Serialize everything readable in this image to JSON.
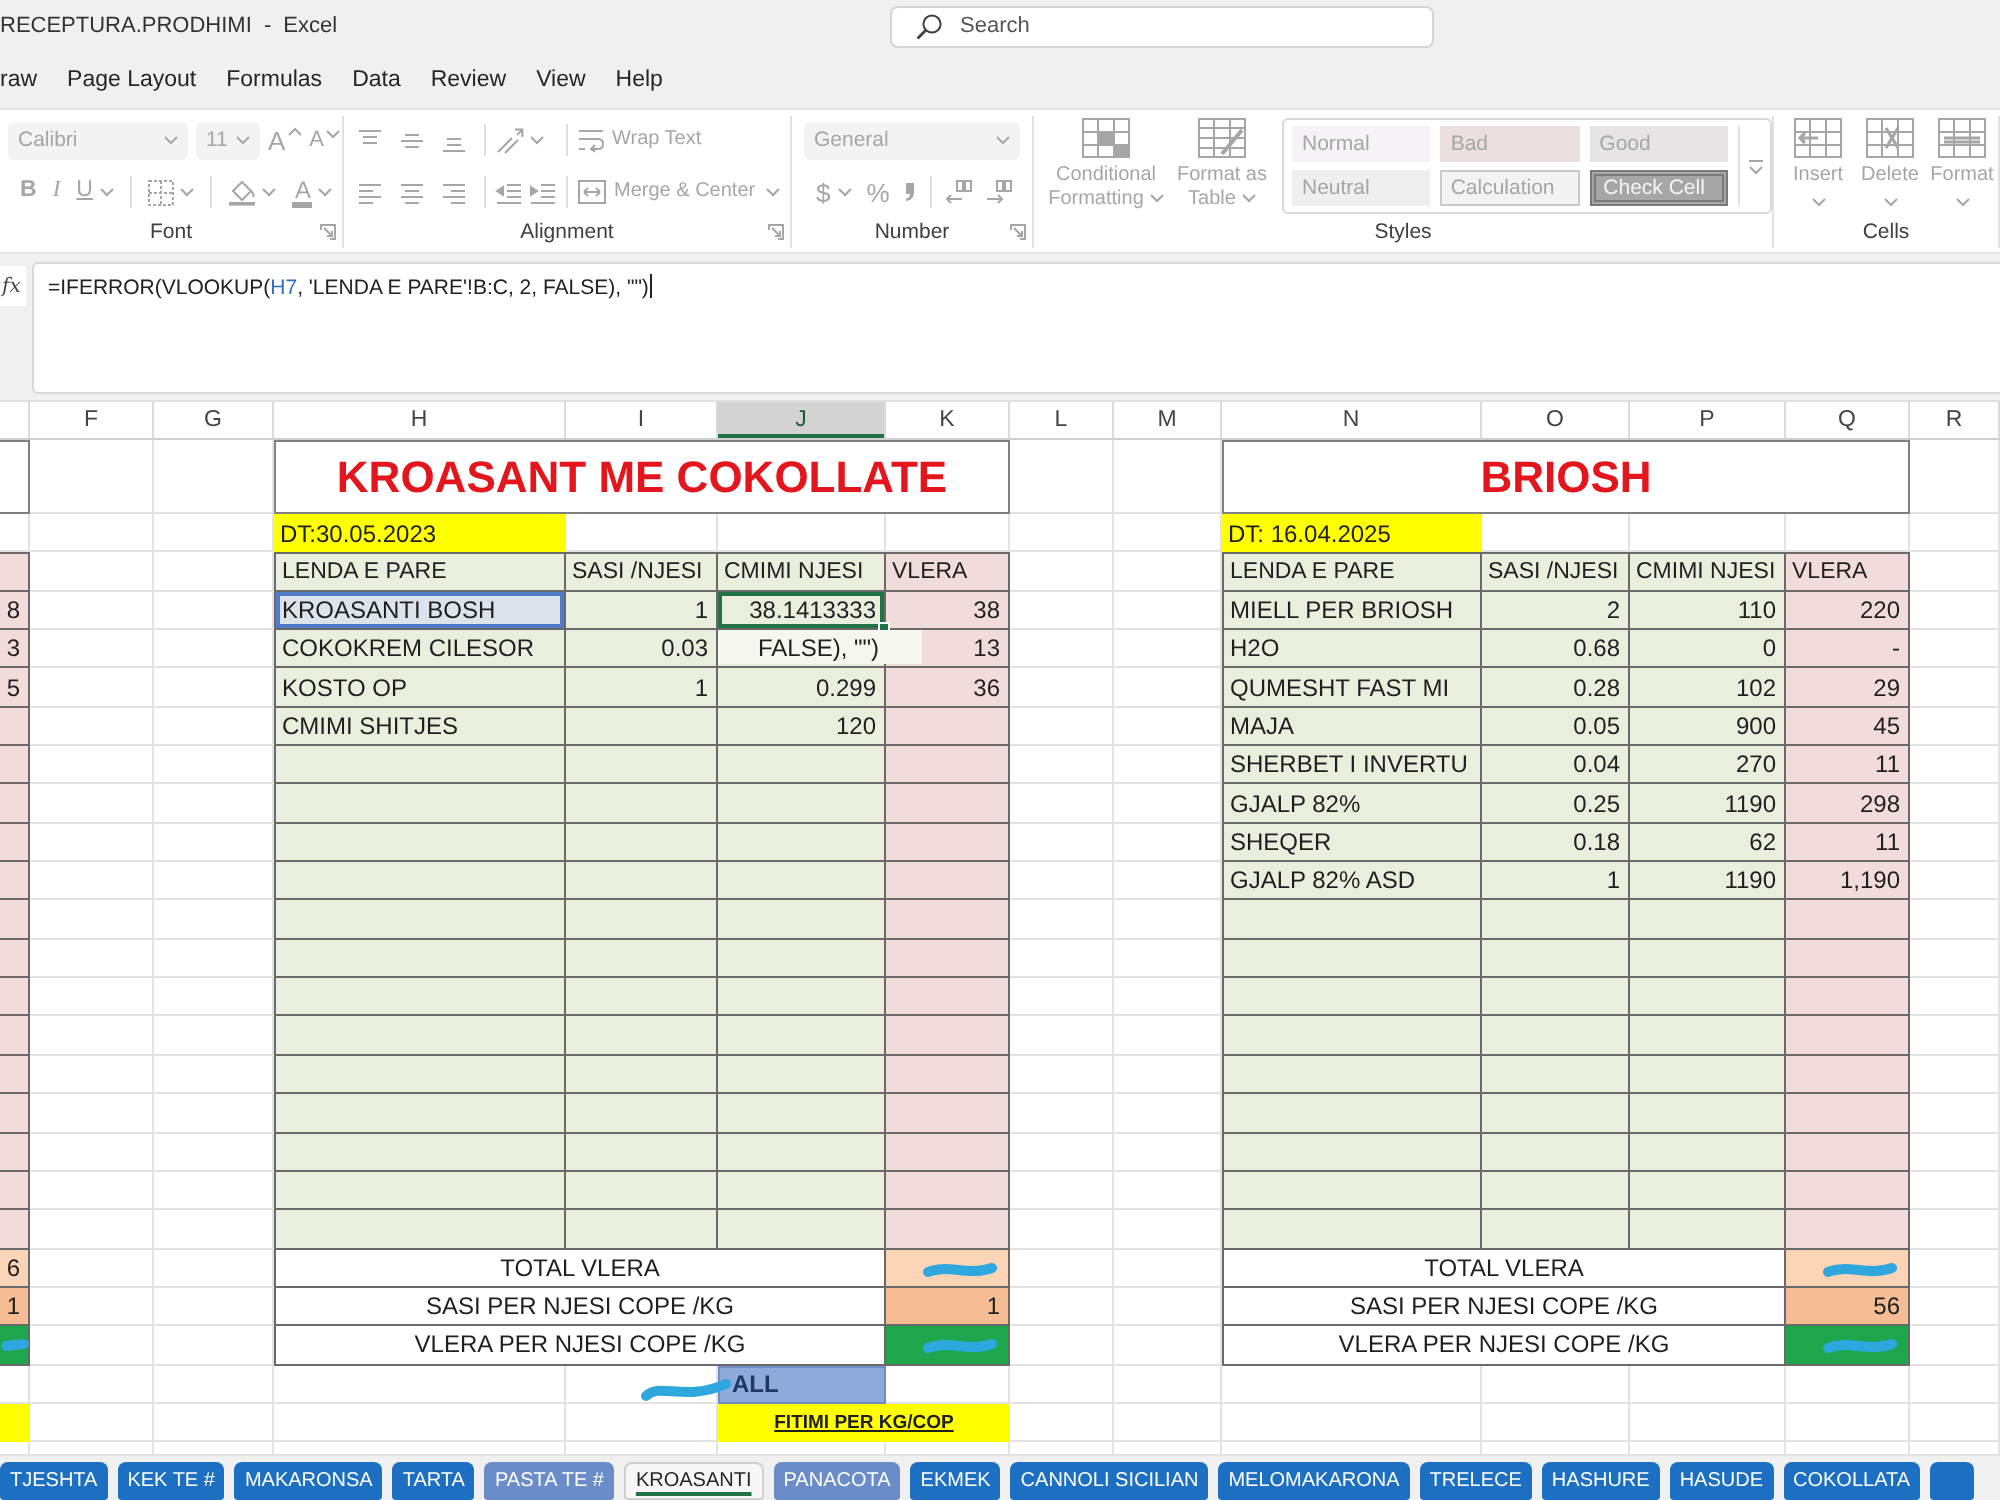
{
  "window": {
    "title": "RECEPTURA.PRODHIMI - Excel"
  },
  "search": {
    "placeholder": "Search"
  },
  "menu": [
    "raw",
    "Page Layout",
    "Formulas",
    "Data",
    "Review",
    "View",
    "Help"
  ],
  "ribbon": {
    "disabled": true,
    "font": {
      "label": "Font",
      "font_name": "Calibri",
      "font_size": "11",
      "size_buttons": [
        {
          "label": "A",
          "kind": "grow"
        },
        {
          "label": "A",
          "kind": "shrink"
        }
      ],
      "style_buttons": [
        {
          "label": "B",
          "kind": "bold"
        },
        {
          "label": "I",
          "kind": "italic"
        },
        {
          "label": "U",
          "kind": "underline"
        }
      ],
      "font_color": "A"
    },
    "alignment": {
      "label": "Alignment",
      "wrap_text": "Wrap Text",
      "merge": "Merge & Center"
    },
    "number": {
      "label": "Number",
      "format": "General",
      "currency": "$",
      "percent": "%"
    },
    "styles": {
      "label": "Styles",
      "conditional_formatting": "Conditional Formatting",
      "format_as_table": "Format as Table",
      "gallery": [
        {
          "label": "Normal",
          "kind": "normal"
        },
        {
          "label": "Bad",
          "kind": "bad"
        },
        {
          "label": "Good",
          "kind": "good"
        },
        {
          "label": "Neutral",
          "kind": "neutral"
        },
        {
          "label": "Calculation",
          "kind": "calculation"
        },
        {
          "label": "Check Cell",
          "kind": "check"
        }
      ]
    },
    "cells": {
      "label": "Cells",
      "buttons": [
        {
          "label": "Insert",
          "kind": "insert"
        },
        {
          "label": "Delete",
          "kind": "delete"
        },
        {
          "label": "Format",
          "kind": "format"
        }
      ]
    }
  },
  "formula_bar": {
    "label": "fx",
    "formula": [
      {
        "text": "=IFERROR(VLOOKUP(",
        "kind": "plain"
      },
      {
        "text": "H7",
        "kind": "reference"
      },
      {
        "text": ", 'LENDA E PARE'!B:C, 2, FALSE), \"\")",
        "kind": "plain"
      }
    ]
  },
  "column_headers": [
    {
      "label": "F",
      "selected": false
    },
    {
      "label": "G",
      "selected": false
    },
    {
      "label": "H",
      "selected": false
    },
    {
      "label": "I",
      "selected": false
    },
    {
      "label": "J",
      "selected": true
    },
    {
      "label": "K",
      "selected": false
    },
    {
      "label": "L",
      "selected": false
    },
    {
      "label": "M",
      "selected": false
    },
    {
      "label": "N",
      "selected": false
    },
    {
      "label": "O",
      "selected": false
    },
    {
      "label": "P",
      "selected": false
    },
    {
      "label": "Q",
      "selected": false
    },
    {
      "label": "R",
      "selected": false
    }
  ],
  "sheet": {
    "edge_table": {
      "values": [
        "8",
        "3",
        "5"
      ],
      "totals": [
        {
          "kind": "total",
          "value": "6",
          "redacted": false
        },
        {
          "kind": "quantity",
          "value": "1",
          "redacted": false
        },
        {
          "kind": "result",
          "redacted": true
        }
      ]
    },
    "tables": [
      {
        "title": "KROASANT ME COKOLLATE",
        "date": "DT:30.05.2023",
        "columns": [
          "LENDA E PARE",
          "SASI /NJESI",
          "CMIMI NJESI",
          "VLERA"
        ],
        "rows": [
          {
            "cells": [
              {
                "text": "KROASANTI BOSH",
                "kind": "reference"
              },
              {
                "text": "1",
                "kind": "plain"
              },
              {
                "text": "38.1413333",
                "kind": "active"
              },
              {
                "text": "38",
                "kind": "plain"
              }
            ]
          },
          {
            "cells": [
              {
                "text": "COKOKREM CILESOR",
                "kind": "plain"
              },
              {
                "text": "0.03",
                "kind": "plain"
              },
              {
                "text": "FALSE), \"\")",
                "kind": "editor"
              },
              {
                "text": "13",
                "kind": "plain"
              }
            ]
          },
          {
            "cells": [
              {
                "text": "KOSTO OP",
                "kind": "plain"
              },
              {
                "text": "1",
                "kind": "plain"
              },
              {
                "text": "0.299",
                "kind": "plain"
              },
              {
                "text": "36",
                "kind": "plain"
              }
            ]
          },
          {
            "cells": [
              {
                "text": "CMIMI SHITJES",
                "kind": "plain"
              },
              {
                "kind": "empty"
              },
              {
                "text": "120",
                "kind": "plain"
              },
              {
                "kind": "empty"
              }
            ]
          }
        ],
        "totals": [
          {
            "label": "TOTAL VLERA",
            "kind": "total",
            "redacted": true
          },
          {
            "label": "SASI PER NJESI COPE /KG",
            "kind": "quantity",
            "value": "1",
            "redacted": false
          },
          {
            "label": "VLERA PER NJESI COPE /KG",
            "kind": "result",
            "redacted": true
          }
        ],
        "profit": {
          "text": "ALL",
          "redacted": true,
          "caption": "FITIMI PER KG/COP"
        }
      },
      {
        "title": "BRIOSH",
        "date": "DT: 16.04.2025",
        "columns": [
          "LENDA E PARE",
          "SASI /NJESI",
          "CMIMI NJESI",
          "VLERA"
        ],
        "rows": [
          {
            "cells": [
              {
                "text": "MIELL PER BRIOSH",
                "kind": "plain"
              },
              {
                "text": "2",
                "kind": "plain"
              },
              {
                "text": "110",
                "kind": "plain"
              },
              {
                "text": "220",
                "kind": "plain"
              }
            ]
          },
          {
            "cells": [
              {
                "text": "H2O",
                "kind": "plain"
              },
              {
                "text": "0.68",
                "kind": "plain"
              },
              {
                "text": "0",
                "kind": "plain"
              },
              {
                "text": "-",
                "kind": "plain"
              }
            ]
          },
          {
            "cells": [
              {
                "text": "QUMESHT FAST MI",
                "kind": "plain"
              },
              {
                "text": "0.28",
                "kind": "plain"
              },
              {
                "text": "102",
                "kind": "plain"
              },
              {
                "text": "29",
                "kind": "plain"
              }
            ]
          },
          {
            "cells": [
              {
                "text": "MAJA",
                "kind": "plain"
              },
              {
                "text": "0.05",
                "kind": "plain"
              },
              {
                "text": "900",
                "kind": "plain"
              },
              {
                "text": "45",
                "kind": "plain"
              }
            ]
          },
          {
            "cells": [
              {
                "text": "SHERBET I INVERTU",
                "kind": "plain"
              },
              {
                "text": "0.04",
                "kind": "plain"
              },
              {
                "text": "270",
                "kind": "plain"
              },
              {
                "text": "11",
                "kind": "plain"
              }
            ]
          },
          {
            "cells": [
              {
                "text": "GJALP 82%",
                "kind": "plain"
              },
              {
                "text": "0.25",
                "kind": "plain"
              },
              {
                "text": "1190",
                "kind": "plain"
              },
              {
                "text": "298",
                "kind": "plain"
              }
            ]
          },
          {
            "cells": [
              {
                "text": "SHEQER",
                "kind": "plain"
              },
              {
                "text": "0.18",
                "kind": "plain"
              },
              {
                "text": "62",
                "kind": "plain"
              },
              {
                "text": "11",
                "kind": "plain"
              }
            ]
          },
          {
            "cells": [
              {
                "text": "GJALP 82% ASD",
                "kind": "plain"
              },
              {
                "text": "1",
                "kind": "plain"
              },
              {
                "text": "1190",
                "kind": "plain"
              },
              {
                "text": "1,190",
                "kind": "plain"
              }
            ]
          }
        ],
        "totals": [
          {
            "label": "TOTAL VLERA",
            "kind": "total",
            "redacted": true
          },
          {
            "label": "SASI PER NJESI COPE /KG",
            "kind": "quantity",
            "value": "56",
            "redacted": false
          },
          {
            "label": "VLERA PER NJESI COPE /KG",
            "kind": "result",
            "redacted": true
          }
        ]
      }
    ]
  },
  "sheet_tabs": [
    {
      "label": "TJESHTA",
      "color": "#1c6fc1",
      "selected": false
    },
    {
      "label": "KEK TE #",
      "color": "#1c6fc1",
      "selected": false
    },
    {
      "label": "MAKARONSA",
      "color": "#1c6fc1",
      "selected": false
    },
    {
      "label": "TARTA",
      "color": "#1c6fc1",
      "selected": false
    },
    {
      "label": "PASTA TE #",
      "color": "#6a8cc8",
      "selected": false
    },
    {
      "label": "KROASANTI",
      "selected": true
    },
    {
      "label": "PANACOTA",
      "color": "#6a8cc8",
      "selected": false
    },
    {
      "label": "EKMEK",
      "color": "#1c6fc1",
      "selected": false
    },
    {
      "label": "CANNOLI SICILIAN",
      "color": "#1c6fc1",
      "selected": false
    },
    {
      "label": "MELOMAKARONA",
      "color": "#1c6fc1",
      "selected": false
    },
    {
      "label": "TRELECE",
      "color": "#1c6fc1",
      "selected": false
    },
    {
      "label": "HASHURE",
      "color": "#1c6fc1",
      "selected": false
    },
    {
      "label": "HASUDE",
      "color": "#1c6fc1",
      "selected": false
    },
    {
      "label": "COKOLLATA",
      "color": "#1c6fc1",
      "selected": false
    },
    {
      "color": "#1c6fc1",
      "selected": false
    }
  ]
}
